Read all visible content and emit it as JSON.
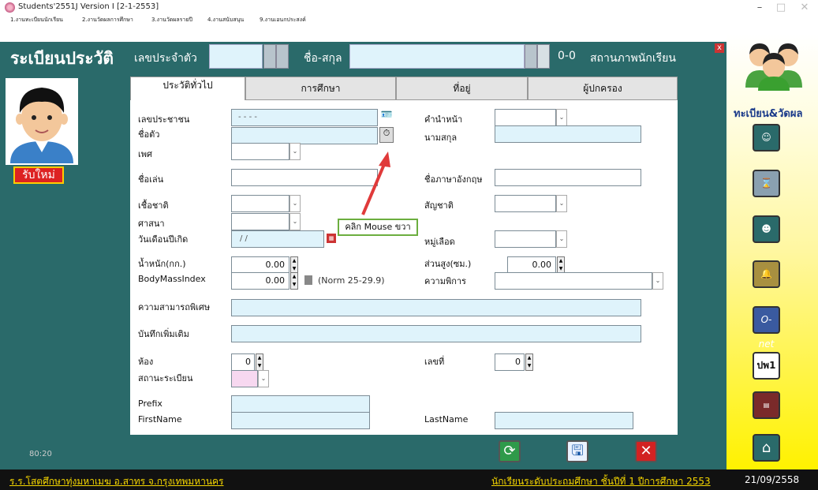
{
  "window": {
    "title": "Students'2551J Version I [2-1-2553]",
    "minimize": "–",
    "maximize": "□",
    "close": "✕"
  },
  "menu": [
    "1.งานทะเบียนนักเรียน",
    "2.งานวัดผลการศึกษา",
    "3.งานวัดผลรายปี",
    "4.งานสนับสนุน",
    "9.งานเอนกประสงค์"
  ],
  "header": {
    "title": "ระเบียนประวัติ",
    "id_label": "เลขประจำตัว",
    "name_label": "ชื่อ-สกุล",
    "counter": "0-0",
    "status_label": "สถานภาพนักเรียน",
    "close": "x"
  },
  "left": {
    "new_button": "รับใหม่"
  },
  "tabs": [
    "ประวัติทั่วไป",
    "การศึกษา",
    "ที่อยู่",
    "ผู้ปกครอง"
  ],
  "form": {
    "national_id_label": "เลขประชาชน",
    "national_id_value": "- - - -",
    "first_name_label": "ชื่อตัว",
    "sex_label": "เพศ",
    "nickname_label": "ชื่อเล่น",
    "race_label": "เชื้อชาติ",
    "religion_label": "ศาสนา",
    "birthdate_label": "วันเดือนปีเกิด",
    "birthdate_value": "/ /",
    "weight_label": "น้ำหนัก(กก.)",
    "weight_value": "0.00",
    "bmi_label": "BodyMassIndex",
    "bmi_value": "0.00",
    "bmi_norm": "(Norm 25-29.9)",
    "talent_label": "ความสามารถพิเศษ",
    "notes_label": "บันทึกเพิ่มเติม",
    "room_label": "ห้อง",
    "room_value": "0",
    "reg_status_label": "สถานะระเบียน",
    "prefix_label": "Prefix",
    "firstname_en_label": "FirstName",
    "prefix_th_label": "คำนำหน้า",
    "surname_label": "นามสกุล",
    "english_name_label": "ชื่อภาษาอังกฤษ",
    "nationality_label": "สัญชาติ",
    "blood_label": "หมู่เลือด",
    "height_label": "ส่วนสูง(ซม.)",
    "height_value": "0.00",
    "disability_label": "ความพิการ",
    "number_label": "เลขที่",
    "number_value": "0",
    "lastname_en_label": "LastName"
  },
  "callout": "คลิก Mouse ขวา",
  "bottom": {
    "ratio": "80:20"
  },
  "right": {
    "label": "ทะเบียน&วัดผล",
    "pw1": "ปพ1"
  },
  "status": {
    "school": "ร.ร.โสตศึกษาทุ่งมหาเมฆ อ.สาทร จ.กรุงเทพมหานคร",
    "level": "นักเรียนระดับประถมศึกษา ชั้นปีที่ 1 ปีการศึกษา 2553",
    "date": "21/09/2558"
  },
  "colors": {
    "teal": "#2a6a6a",
    "yellow": "#f5d600",
    "red": "#d22222"
  }
}
